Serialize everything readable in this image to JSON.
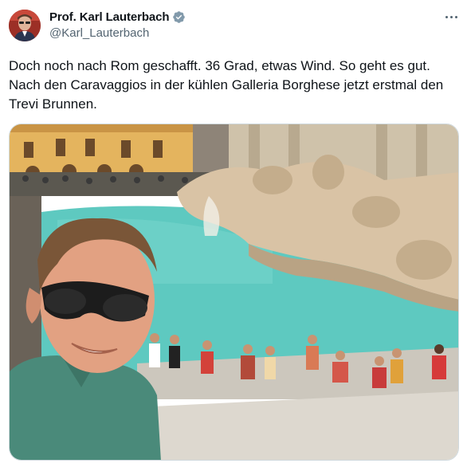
{
  "author": {
    "display_name": "Prof. Karl Lauterbach",
    "handle": "@Karl_Lauterbach",
    "verified": true,
    "avatar_icon": "user-avatar"
  },
  "menu": {
    "more_icon": "more-horizontal-icon"
  },
  "tweet": {
    "text": "Doch noch nach Rom geschafft. 36 Grad, etwas Wind. So geht es gut.\nNach den Caravaggios in der kühlen Galleria Borghese jetzt erstmal den\nTrevi Brunnen."
  },
  "media": {
    "description_icon": "photo-selfie-trevi-fountain",
    "colors": {
      "water": "#5ec9c0",
      "stone": "#d9c3a5",
      "sky_building": "#e8b865",
      "shirt": "#4a8a7a"
    }
  },
  "colors": {
    "verified_badge": "#829aab",
    "secondary_text": "#536471"
  }
}
